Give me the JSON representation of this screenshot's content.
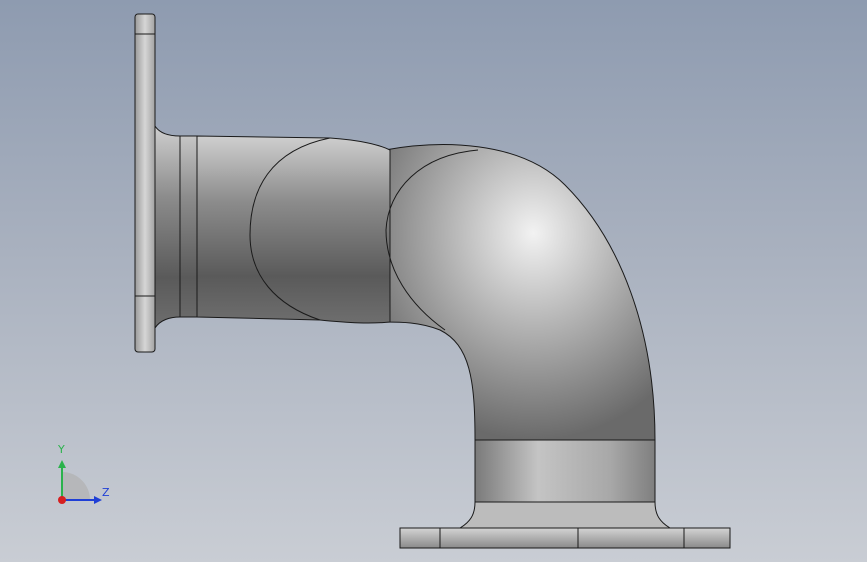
{
  "viewport": {
    "background_top": "#8e9bb0",
    "background_bottom": "#c9cdd4"
  },
  "model": {
    "part": "pipe-elbow-90",
    "features": [
      "vertical-flange",
      "straight-pipe-segment",
      "bend",
      "collar",
      "base-flange"
    ],
    "shade_color": "#a6a6a6",
    "edge_color": "#1a1a1a"
  },
  "triad": {
    "y_label": "Y",
    "z_label": "Z",
    "y_color": "#2bb24c",
    "z_color": "#1f3fd6",
    "x_color": "#d62020"
  }
}
